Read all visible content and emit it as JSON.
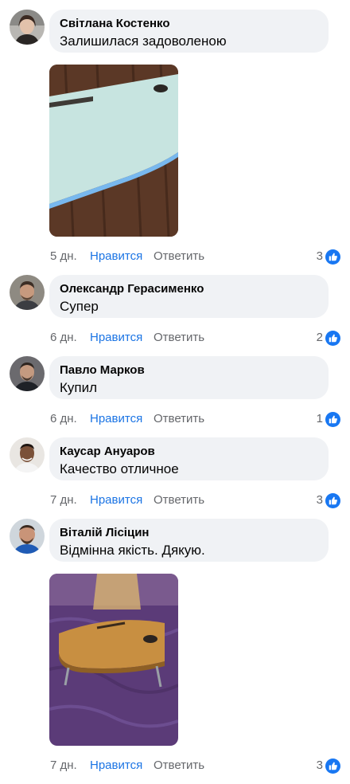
{
  "ui": {
    "like_label": "Нравится",
    "reply_label": "Ответить",
    "like_color": "#1b74e4",
    "bubble_bg": "#f0f2f5",
    "meta_color": "#65676b"
  },
  "comments": [
    {
      "author": "Світлана Костенко",
      "text": "Залишилася задоволеною",
      "time": "5 дн.",
      "reactions": "3",
      "has_photo": true,
      "photo_icon": "photo-white-desk"
    },
    {
      "author": "Олександр Герасименко",
      "text": "Супер",
      "time": "6 дн.",
      "reactions": "2",
      "has_photo": false
    },
    {
      "author": "Павло Марков",
      "text": "Купил",
      "time": "6 дн.",
      "reactions": "1",
      "has_photo": false
    },
    {
      "author": "Каусар Ануаров",
      "text": "Качество отличное",
      "time": "7 дн.",
      "reactions": "3",
      "has_photo": false
    },
    {
      "author": "Віталій Лісіцин",
      "text": "Відмінна якість. Дякую.",
      "time": "7 дн.",
      "reactions": "3",
      "has_photo": true,
      "photo_icon": "photo-wood-desk-on-bed"
    }
  ]
}
